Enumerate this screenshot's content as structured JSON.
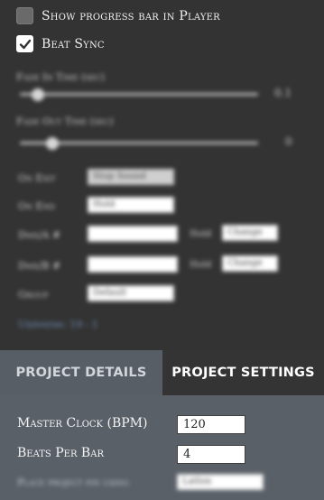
{
  "checkboxes": [
    {
      "label": "Show progress bar in Player",
      "checked": false
    },
    {
      "label": "Beat Sync",
      "checked": true
    }
  ],
  "sliders": [
    {
      "label": "Fade In Time (sec)",
      "value_text": "0.1",
      "fraction": 0.06
    },
    {
      "label": "Fade Out Time (sec)",
      "value_text": "0",
      "fraction": 0.12
    }
  ],
  "fields": {
    "on_exit": {
      "label": "On Exit",
      "value": "Stop Sound"
    },
    "on_end": {
      "label": "On End",
      "value": "Hold"
    },
    "dmx_a": {
      "label": "Dmx/A #",
      "value": "",
      "mini_label": "Hold",
      "mini_value": "Change"
    },
    "dmx_b": {
      "label": "Dmx/B #",
      "value": "",
      "mini_label": "Hold",
      "mini_value": "Change"
    },
    "group": {
      "label": "Group",
      "value": "Default"
    }
  },
  "link_text": "Universe: 19 - 1",
  "tabs": [
    {
      "label": "PROJECT DETAILS",
      "active": false
    },
    {
      "label": "PROJECT SETTINGS",
      "active": true
    }
  ],
  "settings": {
    "master_clock_label": "Master Clock (BPM)",
    "master_clock_value": "120",
    "beats_per_bar_label": "Beats Per Bar",
    "beats_per_bar_value": "4",
    "place_label": "Place project pin using",
    "place_value": "Latlon"
  },
  "colors": {
    "tab_inactive_bg": "#585e66",
    "panel_bg": "#5a6068",
    "top_bg": "#333333"
  },
  "icons": {
    "checkmark": "check-icon"
  }
}
